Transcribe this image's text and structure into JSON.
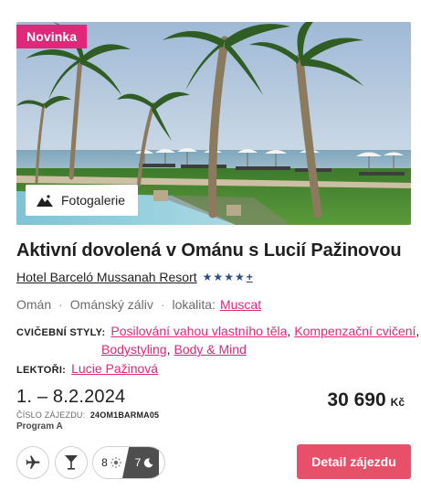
{
  "badge": "Novinka",
  "gallery": {
    "label": "Fotogalerie",
    "icon": "mountain-photo-icon"
  },
  "title": "Aktivní dovolená v Ománu s Lucií Pažinovou",
  "hotel": {
    "name": "Hotel Barceló Mussanah Resort",
    "stars": 4,
    "plus": "+"
  },
  "location": {
    "country": "Omán",
    "region": "Ománský záliv",
    "locality_label": "lokalita:",
    "locality": "Muscat"
  },
  "styles": {
    "label": "CVIČEBNÍ STYLY:",
    "items": [
      "Posilování vahou vlastního těla",
      "Kompenzační cvičení",
      "Bodystyling",
      "Body & Mind"
    ]
  },
  "lectors": {
    "label": "LEKTOŘI:",
    "name": "Lucie Pažinová"
  },
  "dates": "1. – 8.2.2024",
  "tour_code": {
    "label": "ČÍSLO ZÁJEZDU:",
    "value": "24OM1BARMA05"
  },
  "program": "Program A",
  "price": {
    "amount": "30 690",
    "currency": "Kč"
  },
  "transport_icons": [
    "airplane-icon",
    "cocktail-glass-icon"
  ],
  "duration": {
    "days": "8",
    "nights": "7",
    "day_icon": "sun-icon",
    "night_icon": "moon-icon"
  },
  "detail_button": "Detail zájezdu",
  "colors": {
    "accent": "#e0287a",
    "button": "#e8506a",
    "stars": "#2c4a8a"
  }
}
